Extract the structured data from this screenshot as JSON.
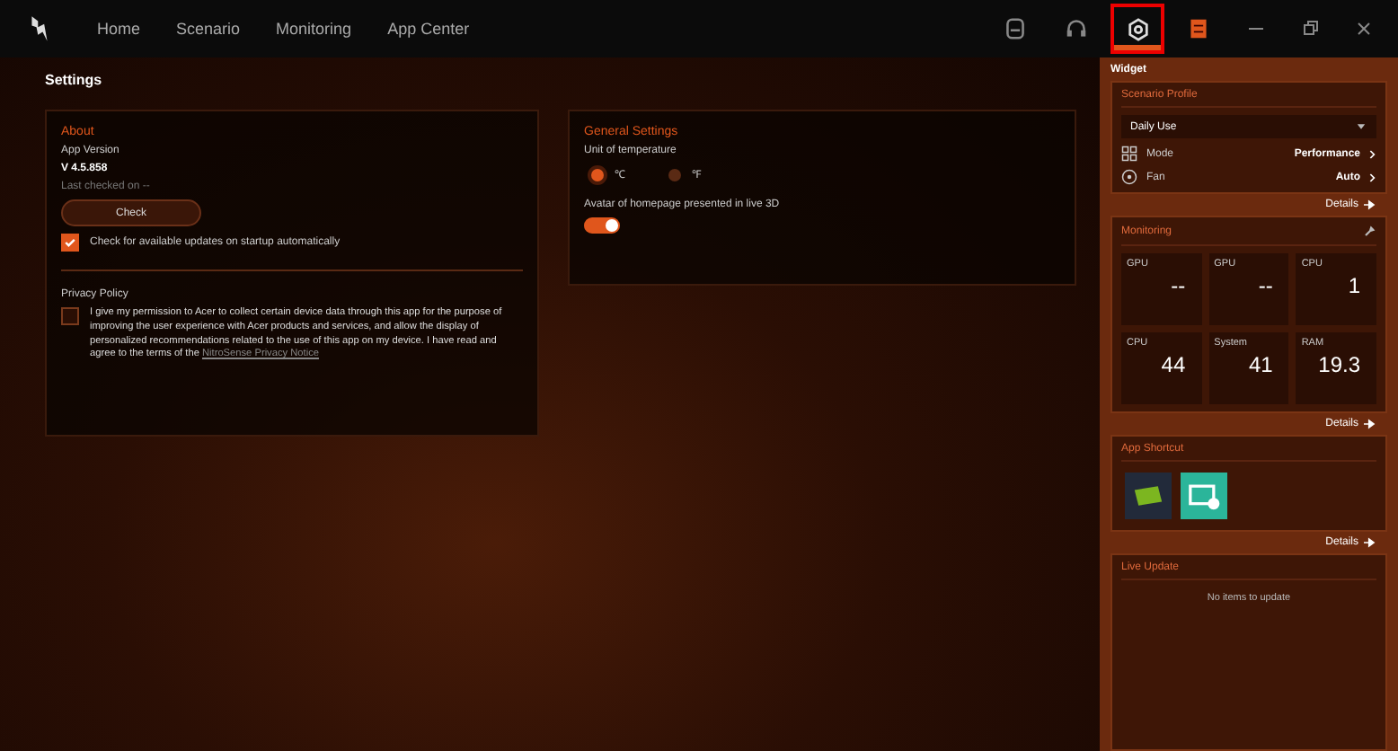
{
  "nav": {
    "items": [
      {
        "label": "Home",
        "selected": false
      },
      {
        "label": "Scenario",
        "selected": false
      },
      {
        "label": "Monitoring",
        "selected": false
      },
      {
        "label": "App Center",
        "selected": false
      }
    ],
    "toolbar": [
      {
        "kind": "profile",
        "selected": false
      },
      {
        "kind": "headset",
        "selected": false
      },
      {
        "kind": "settings",
        "selected": true
      },
      {
        "kind": "widget",
        "selected": false
      }
    ]
  },
  "page_title": "Settings",
  "about": {
    "title": "About",
    "version_label": "App Version",
    "version": "V 4.5.858",
    "last_checked": "Last checked on --",
    "check_button": "Check",
    "auto_update": {
      "label": "Check for available updates on startup automatically",
      "checked": true
    }
  },
  "privacy": {
    "title": "Privacy Policy",
    "checked": false,
    "text": "I give my permission to Acer to collect certain device data through this app for the purpose of improving the user experience with Acer products and services, and allow the display of personalized recommendations related to the use of this app on my device. I have read and agree to the terms of the",
    "link": "NitroSense Privacy Notice"
  },
  "general": {
    "title": "General Settings",
    "unit_label": "Unit of temperature",
    "units": [
      {
        "label": "℃",
        "selected": true
      },
      {
        "label": "℉",
        "selected": false
      }
    ],
    "avatar_label": "Avatar of homepage presented in live 3D",
    "avatar_on": true
  },
  "widget": {
    "title": "Widget",
    "scenario": {
      "title": "Scenario Profile",
      "profile": "Daily Use",
      "rows": [
        {
          "kind": "mode",
          "label": "Mode",
          "value": "Performance"
        },
        {
          "kind": "fan",
          "label": "Fan",
          "value": "Auto"
        }
      ],
      "details": "Details"
    },
    "monitoring": {
      "title": "Monitoring",
      "tiles": [
        {
          "label": "GPU",
          "value": "--"
        },
        {
          "label": "GPU",
          "value": "--"
        },
        {
          "label": "CPU",
          "value": "1"
        },
        {
          "label": "CPU",
          "value": "44"
        },
        {
          "label": "System",
          "value": "41"
        },
        {
          "label": "RAM",
          "value": "19.3"
        }
      ],
      "details": "Details"
    },
    "shortcut": {
      "title": "App Shortcut",
      "apps": [
        {
          "kind": "graphics"
        },
        {
          "kind": "capture"
        }
      ],
      "details": "Details"
    },
    "live_update": {
      "title": "Live Update",
      "message": "No items to update"
    }
  }
}
